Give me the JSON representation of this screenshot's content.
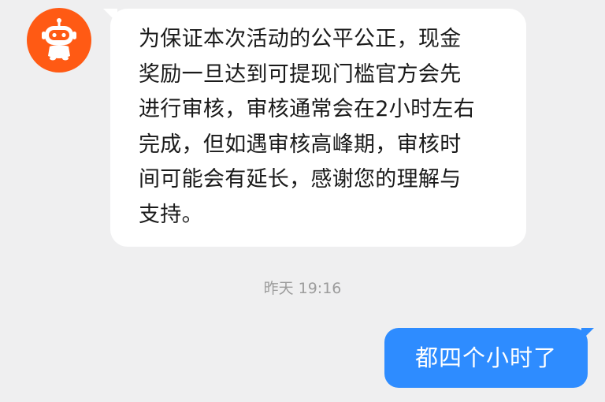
{
  "chat": {
    "bot_avatar_icon": "robot-icon",
    "brand_color": "#ff5a14",
    "outgoing_bubble_color": "#2e8cff",
    "messages": [
      {
        "direction": "incoming",
        "text": "为保证本次活动的公平公正，现金\n奖励一旦达到可提现门槛官方会先\n进行审核，审核通常会在2小时左右\n完成，但如遇审核高峰期，审核时\n间可能会有延长，感谢您的理解与\n支持。"
      },
      {
        "direction": "outgoing",
        "text": "都四个小时了"
      }
    ],
    "timestamp": "昨天 19:16"
  }
}
